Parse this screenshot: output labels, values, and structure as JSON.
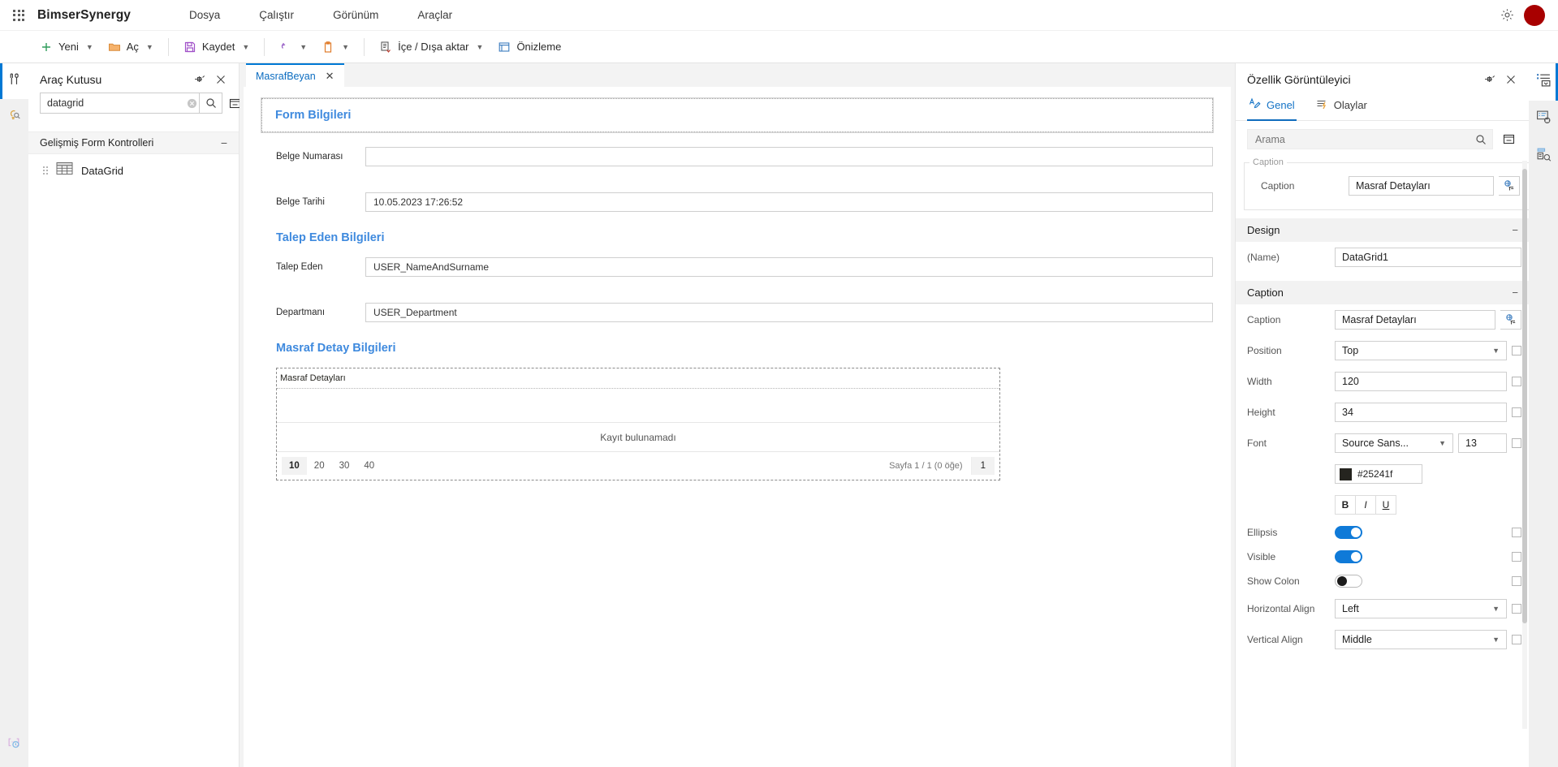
{
  "topbar": {
    "waffle_icon": "app-launcher-icon",
    "brand": "BimserSynergy",
    "menu": [
      {
        "label": "Dosya"
      },
      {
        "label": "Çalıştır"
      },
      {
        "label": "Görünüm"
      },
      {
        "label": "Araçlar"
      }
    ],
    "settings_icon": "gear-icon",
    "avatar_color": "#a80000"
  },
  "ribbon": {
    "items": [
      {
        "label": "Yeni",
        "icon": "plus-icon",
        "caret": true
      },
      {
        "label": "Aç",
        "icon": "folder-icon",
        "caret": true
      },
      {
        "label": "Kaydet",
        "icon": "save-icon",
        "caret": true
      },
      {
        "label": "",
        "icon": "undo-icon",
        "caret": true
      },
      {
        "label": "",
        "icon": "clipboard-icon",
        "caret": true
      },
      {
        "label": "İçe / Dışa aktar",
        "icon": "import-export-icon",
        "caret": true
      },
      {
        "label": "Önizleme",
        "icon": "preview-icon",
        "caret": false
      }
    ]
  },
  "left_rail": {
    "items": [
      {
        "icon": "toolbox-icon",
        "active": true
      },
      {
        "icon": "lightbulb-search-icon",
        "active": false
      }
    ],
    "bottom_icon": "widget-help-icon"
  },
  "toolbox": {
    "title": "Araç Kutusu",
    "pin_icon": "pin-icon",
    "close_icon": "close-icon",
    "search": {
      "value": "datagrid",
      "placeholder": "Ara",
      "clear_icon": "clear-icon",
      "search_icon": "search-icon"
    },
    "collapse_icon": "collapse-all-icon",
    "group": {
      "label": "Gelişmiş Form Kontrolleri",
      "collapse": "−"
    },
    "items": [
      {
        "label": "DataGrid",
        "icon": "datagrid-icon",
        "grip": "drag-handle-icon"
      }
    ]
  },
  "center": {
    "tab": {
      "label": "MasrafBeyan",
      "close": "✕"
    },
    "form": {
      "section1": {
        "title": "Form Bilgileri"
      },
      "fields1": [
        {
          "label": "Belge Numarası",
          "value": ""
        },
        {
          "label": "Belge Tarihi",
          "value": "10.05.2023 17:26:52"
        }
      ],
      "section2": {
        "title": "Talep Eden Bilgileri"
      },
      "fields2": [
        {
          "label": "Talep Eden",
          "value": "USER_NameAndSurname"
        },
        {
          "label": "Departmanı",
          "value": "USER_Department"
        }
      ],
      "section3": {
        "title": "Masraf Detay Bilgileri"
      }
    },
    "datagrid": {
      "caption": "Masraf Detayları",
      "empty_text": "Kayıt bulunamadı",
      "page_sizes": [
        "10",
        "20",
        "30",
        "40"
      ],
      "active_page_size": "10",
      "page_info": "Sayfa 1 / 1 (0 öğe)",
      "current_page": "1"
    }
  },
  "props": {
    "title": "Özellik Görüntüleyici",
    "pin_icon": "pin-icon",
    "close_icon": "close-icon",
    "tabs": [
      {
        "label": "Genel",
        "icon": "properties-icon",
        "active": true
      },
      {
        "label": "Olaylar",
        "icon": "events-icon",
        "active": false
      }
    ],
    "search": {
      "value": "",
      "placeholder": "Arama",
      "search_icon": "search-icon"
    },
    "collapse_icon": "collapse-all-icon",
    "caption_fieldset": {
      "legend": "Caption",
      "label": "Caption",
      "value": "Masraf Detayları",
      "translate_icon": "translate-icon"
    },
    "groups": [
      {
        "name": "Design",
        "collapse": "−",
        "rows": [
          {
            "label": "(Name)",
            "type": "text",
            "value": "DataGrid1",
            "checkbox": false
          }
        ]
      },
      {
        "name": "Caption",
        "collapse": "−",
        "rows": [
          {
            "label": "Caption",
            "type": "text-translate",
            "value": "Masraf Detayları",
            "translate_icon": "translate-icon",
            "checkbox": false
          },
          {
            "label": "Position",
            "type": "select",
            "value": "Top",
            "checkbox": true
          },
          {
            "label": "Width",
            "type": "text",
            "value": "120",
            "checkbox": true
          },
          {
            "label": "Height",
            "type": "text",
            "value": "34",
            "checkbox": true
          },
          {
            "label": "Font",
            "type": "font",
            "font_family": "Source Sans...",
            "font_size": "13",
            "color_hex": "#25241f",
            "bold": "B",
            "italic": "I",
            "underline": "U",
            "checkbox": true
          },
          {
            "label": "Ellipsis",
            "type": "toggle",
            "value": "on",
            "checkbox": true
          },
          {
            "label": "Visible",
            "type": "toggle",
            "value": "on",
            "checkbox": true
          },
          {
            "label": "Show Colon",
            "type": "toggle",
            "value": "off",
            "checkbox": true
          },
          {
            "label": "Horizontal Align",
            "type": "select",
            "value": "Left",
            "checkbox": true
          },
          {
            "label": "Vertical Align",
            "type": "select",
            "value": "Middle",
            "checkbox": true
          }
        ]
      }
    ]
  },
  "right_rail": {
    "items": [
      {
        "icon": "form-outline-icon",
        "active": true
      },
      {
        "icon": "form-settings-icon",
        "active": false
      },
      {
        "icon": "form-inspect-icon",
        "active": false
      }
    ]
  }
}
